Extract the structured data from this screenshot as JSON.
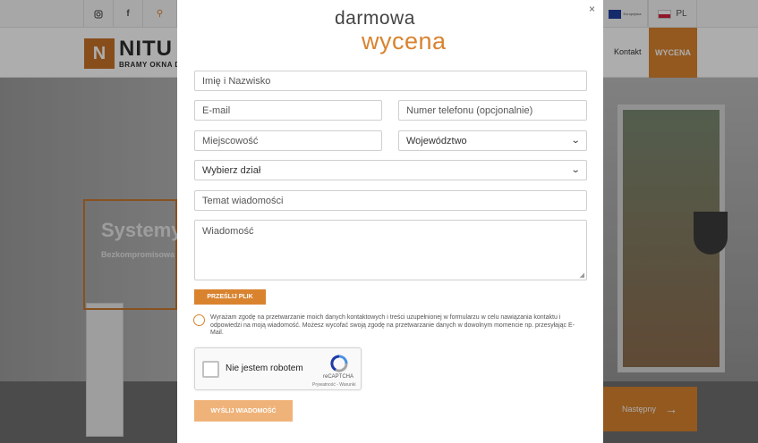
{
  "site": {
    "topbar": {
      "social": [
        "instagram-icon",
        "facebook-icon",
        "link-icon"
      ],
      "language": "PL",
      "eu_text": "Europejska"
    },
    "logo": {
      "mark": "N",
      "name": "NITU",
      "tagline": "BRAMY OKNA D"
    },
    "nav": {
      "contact": "Kontakt",
      "cta": "WYCENA"
    },
    "hero": {
      "title": "Systemy",
      "subtitle": "Bezkompromisowa",
      "next": "Następny"
    }
  },
  "modal": {
    "close_label": "×",
    "title_line1": "darmowa",
    "title_line2": "wycena",
    "fields": {
      "name": "Imię i Nazwisko",
      "email": "E-mail",
      "phone": "Numer telefonu (opcjonalnie)",
      "city": "Miejscowość",
      "region": "Województwo",
      "department": "Wybierz dział",
      "subject": "Temat wiadomości",
      "message": "Wiadomość"
    },
    "upload_label": "PRZEŚLIJ PLIK",
    "consent": "Wyrażam zgodę na przetwarzanie moich danych kontaktowych i treści uzupełnionej w formularzu w celu nawiązania kontaktu i odpowiedzi na moją wiadomość. Możesz wycofać swoją zgodę na przetwarzanie danych w dowolnym momencie np. przesyłając E-Mail.",
    "captcha": {
      "label": "Nie jestem robotem",
      "brand": "reCAPTCHA",
      "terms": "Prywatność - Warunki"
    },
    "submit_label": "WYŚLIJ WIADOMOŚĆ"
  },
  "colors": {
    "accent": "#d9832f",
    "accent_light": "#efb37a"
  }
}
